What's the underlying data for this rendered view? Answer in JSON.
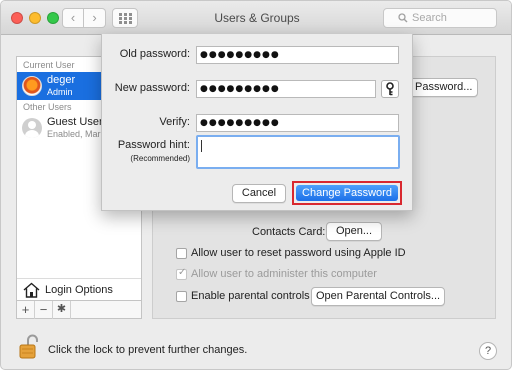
{
  "window": {
    "title": "Users & Groups"
  },
  "toolbar": {
    "search_placeholder": "Search",
    "back_glyph": "‹",
    "forward_glyph": "›"
  },
  "sidebar": {
    "current_user_label": "Current User",
    "current_user": {
      "name": "deger",
      "role": "Admin"
    },
    "other_users_label": "Other Users",
    "other_users": [
      {
        "name": "Guest User",
        "status": "Enabled, Mar"
      }
    ],
    "login_options_label": "Login Options",
    "add_glyph": "+",
    "remove_glyph": "−",
    "gear_glyph": "✱"
  },
  "main": {
    "change_password_button_partial": "Password...",
    "contacts_card_label": "Contacts Card:",
    "open_button": "Open...",
    "checkboxes": [
      {
        "label": "Allow user to reset password using Apple ID",
        "checked": false,
        "disabled": false
      },
      {
        "label": "Allow user to administer this computer",
        "checked": true,
        "disabled": true
      },
      {
        "label": "Enable parental controls",
        "checked": false,
        "disabled": false
      }
    ],
    "open_parental_controls_button": "Open Parental Controls..."
  },
  "footer": {
    "lock_text": "Click the lock to prevent further changes.",
    "help_glyph": "?"
  },
  "sheet": {
    "old_password_label": "Old password:",
    "old_password_value": "●●●●●●●●●",
    "new_password_label": "New password:",
    "new_password_value": "●●●●●●●●●",
    "verify_label": "Verify:",
    "verify_value": "●●●●●●●●●",
    "hint_label": "Password hint:",
    "hint_sublabel": "(Recommended)",
    "hint_value": "",
    "cancel_button": "Cancel",
    "change_password_button": "Change Password"
  },
  "colors": {
    "accent": "#1a6fe0",
    "highlight_outline": "#d9282f",
    "focus_ring": "#7aaef0"
  }
}
